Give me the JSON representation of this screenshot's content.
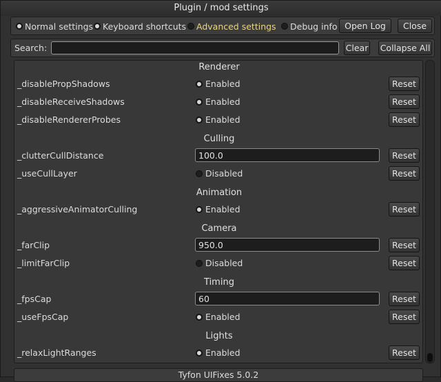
{
  "window": {
    "title": "Plugin / mod settings"
  },
  "tabs": {
    "normal": "Normal settings",
    "keyboard": "Keyboard shortcuts",
    "advanced": "Advanced settings",
    "debug": "Debug info",
    "open_log": "Open Log",
    "close": "Close"
  },
  "search": {
    "label": "Search:",
    "value": "",
    "clear": "Clear",
    "collapse": "Collapse All"
  },
  "sections": {
    "renderer": "Renderer",
    "culling": "Culling",
    "animation": "Animation",
    "camera": "Camera",
    "timing": "Timing",
    "lights": "Lights"
  },
  "settings": {
    "disablePropShadows": {
      "name": "_disablePropShadows",
      "state": "Enabled",
      "reset": "Reset"
    },
    "disableReceiveShadows": {
      "name": "_disableReceiveShadows",
      "state": "Enabled",
      "reset": "Reset"
    },
    "disableRendererProbes": {
      "name": "_disableRendererProbes",
      "state": "Enabled",
      "reset": "Reset"
    },
    "clutterCullDistance": {
      "name": "_clutterCullDistance",
      "value": "100.0",
      "reset": "Reset"
    },
    "useCullLayer": {
      "name": "_useCullLayer",
      "state": "Disabled",
      "reset": "Reset"
    },
    "aggressiveAnimatorCulling": {
      "name": "_aggressiveAnimatorCulling",
      "state": "Enabled",
      "reset": "Reset"
    },
    "farClip": {
      "name": "_farClip",
      "value": "950.0",
      "reset": "Reset"
    },
    "limitFarClip": {
      "name": "_limitFarClip",
      "state": "Disabled",
      "reset": "Reset"
    },
    "fpsCap": {
      "name": "_fpsCap",
      "value": "60",
      "reset": "Reset"
    },
    "useFpsCap": {
      "name": "_useFpsCap",
      "state": "Enabled",
      "reset": "Reset"
    },
    "relaxLightRanges": {
      "name": "_relaxLightRanges",
      "state": "Enabled",
      "reset": "Reset"
    }
  },
  "footer": {
    "text": "Tyfon UIFixes 5.0.2"
  }
}
